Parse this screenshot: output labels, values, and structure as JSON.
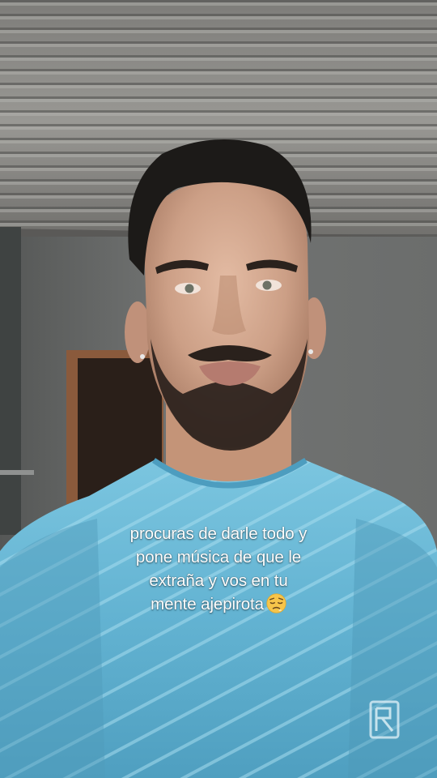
{
  "overlay": {
    "caption_lines": [
      "procuras de darle todo y",
      "pone música de que le",
      "extraña y vos en tu",
      "mente ajepirota"
    ],
    "emoji": "pensive-tired-face"
  },
  "colors": {
    "ceiling": "#8a8986",
    "wall": "#6e706e",
    "shirt": "#6bb9d6",
    "skin": "#cfa48c",
    "hair": "#1c1a18",
    "caption_text": "#ffffff"
  }
}
